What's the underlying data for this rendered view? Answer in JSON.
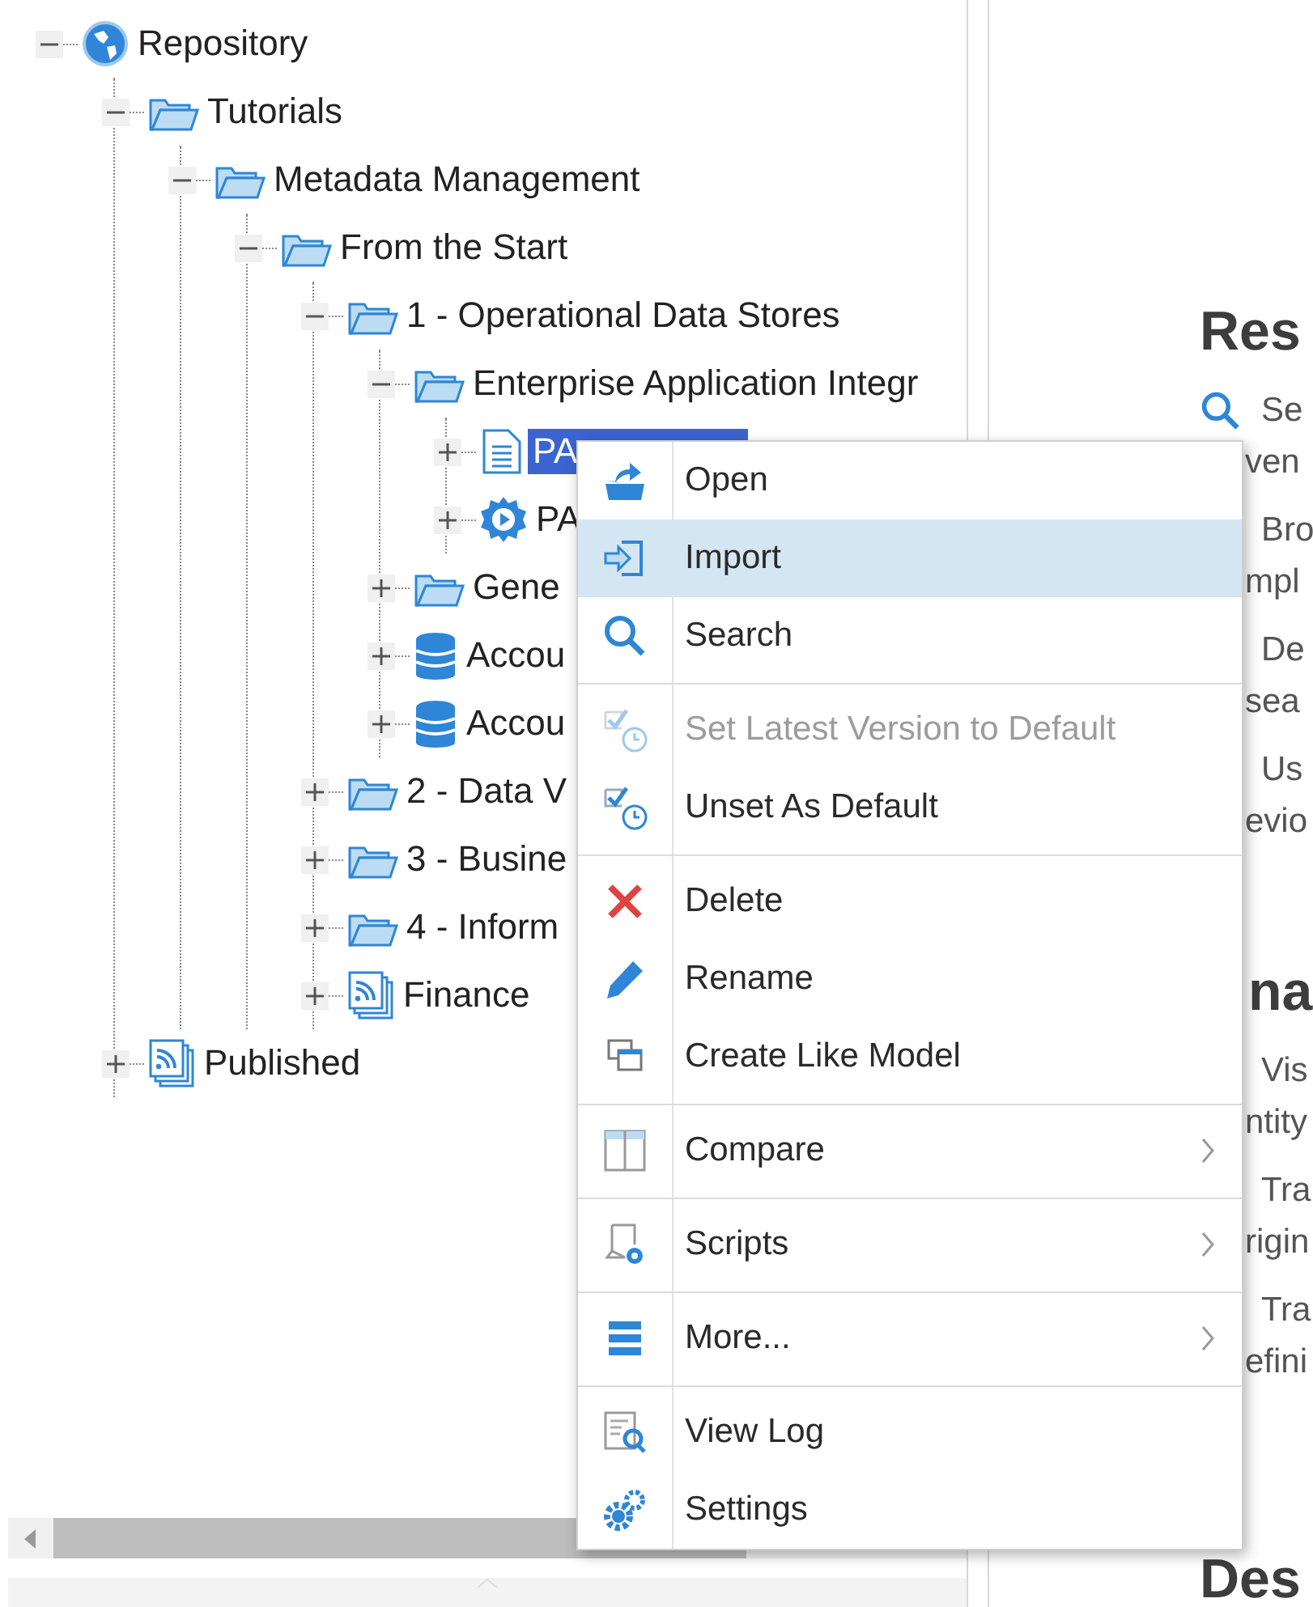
{
  "tree": [
    {
      "label": "Repository",
      "kind": "repository",
      "expanded": true,
      "selected": false,
      "children": [
        {
          "label": "Tutorials",
          "kind": "folder",
          "expanded": true,
          "selected": false,
          "children": [
            {
              "label": "Metadata Management",
              "kind": "folder",
              "expanded": true,
              "selected": false,
              "children": [
                {
                  "label": "From the Start",
                  "kind": "folder",
                  "expanded": true,
                  "selected": false,
                  "children": [
                    {
                      "label": "1 - Operational Data Stores",
                      "kind": "folder",
                      "expanded": true,
                      "selected": false,
                      "children": [
                        {
                          "label": "Enterprise Application Integr",
                          "kind": "folder",
                          "expanded": true,
                          "selected": false,
                          "children": [
                            {
                              "label": "PA",
                              "kind": "model",
                              "expanded": false,
                              "selected": true
                            },
                            {
                              "label": "PA",
                              "kind": "process",
                              "expanded": false,
                              "selected": false
                            }
                          ]
                        },
                        {
                          "label": "Gene",
                          "kind": "folder",
                          "expanded": false,
                          "selected": false
                        },
                        {
                          "label": "Accou",
                          "kind": "database",
                          "expanded": false,
                          "selected": false
                        },
                        {
                          "label": "Accou",
                          "kind": "database",
                          "expanded": false,
                          "selected": false
                        }
                      ]
                    },
                    {
                      "label": "2 - Data V",
                      "kind": "folder",
                      "expanded": false,
                      "selected": false
                    },
                    {
                      "label": "3 - Busine",
                      "kind": "folder",
                      "expanded": false,
                      "selected": false
                    },
                    {
                      "label": "4 - Inform",
                      "kind": "folder",
                      "expanded": false,
                      "selected": false
                    },
                    {
                      "label": "Finance",
                      "kind": "publication",
                      "expanded": false,
                      "selected": false
                    }
                  ]
                }
              ]
            }
          ]
        },
        {
          "label": "Published",
          "kind": "publication",
          "expanded": false,
          "selected": false
        }
      ]
    }
  ],
  "content": {
    "sections": [
      {
        "heading": "Res",
        "items": [
          {
            "kind": "search",
            "lines": [
              "Se",
              "ven"
            ]
          },
          {
            "kind": "plain",
            "lines": [
              "Bro",
              "mpl"
            ]
          },
          {
            "kind": "plain",
            "lines": [
              "De",
              "sea"
            ]
          },
          {
            "kind": "plain",
            "lines": [
              "Us",
              "evio"
            ]
          }
        ]
      },
      {
        "heading": "na",
        "items": [
          {
            "kind": "plain",
            "lines": [
              "Vis",
              "ntity"
            ]
          },
          {
            "kind": "plain",
            "lines": [
              "Tra",
              "rigin"
            ]
          },
          {
            "kind": "plain",
            "lines": [
              "Tra",
              "efini"
            ]
          }
        ]
      },
      {
        "heading": "Des"
      }
    ]
  },
  "menu": {
    "groups": [
      [
        {
          "label": "Open",
          "disabled": false,
          "selected": false,
          "submenu": false
        },
        {
          "label": "Import",
          "disabled": false,
          "selected": true,
          "submenu": false
        },
        {
          "label": "Search",
          "disabled": false,
          "selected": false,
          "submenu": false
        }
      ],
      [
        {
          "label": "Set Latest Version to Default",
          "disabled": true,
          "selected": false,
          "submenu": false
        },
        {
          "label": "Unset As Default",
          "disabled": false,
          "selected": false,
          "submenu": false
        }
      ],
      [
        {
          "label": "Delete",
          "disabled": false,
          "selected": false,
          "submenu": false
        },
        {
          "label": "Rename",
          "disabled": false,
          "selected": false,
          "submenu": false
        },
        {
          "label": "Create Like Model",
          "disabled": false,
          "selected": false,
          "submenu": false
        }
      ],
      [
        {
          "label": "Compare",
          "disabled": false,
          "selected": false,
          "submenu": true
        }
      ],
      [
        {
          "label": "Scripts",
          "disabled": false,
          "selected": false,
          "submenu": true
        }
      ],
      [
        {
          "label": "More...",
          "disabled": false,
          "selected": false,
          "submenu": true
        }
      ],
      [
        {
          "label": "View Log",
          "disabled": false,
          "selected": false,
          "submenu": false
        },
        {
          "label": "Settings",
          "disabled": false,
          "selected": false,
          "submenu": false
        }
      ]
    ]
  }
}
